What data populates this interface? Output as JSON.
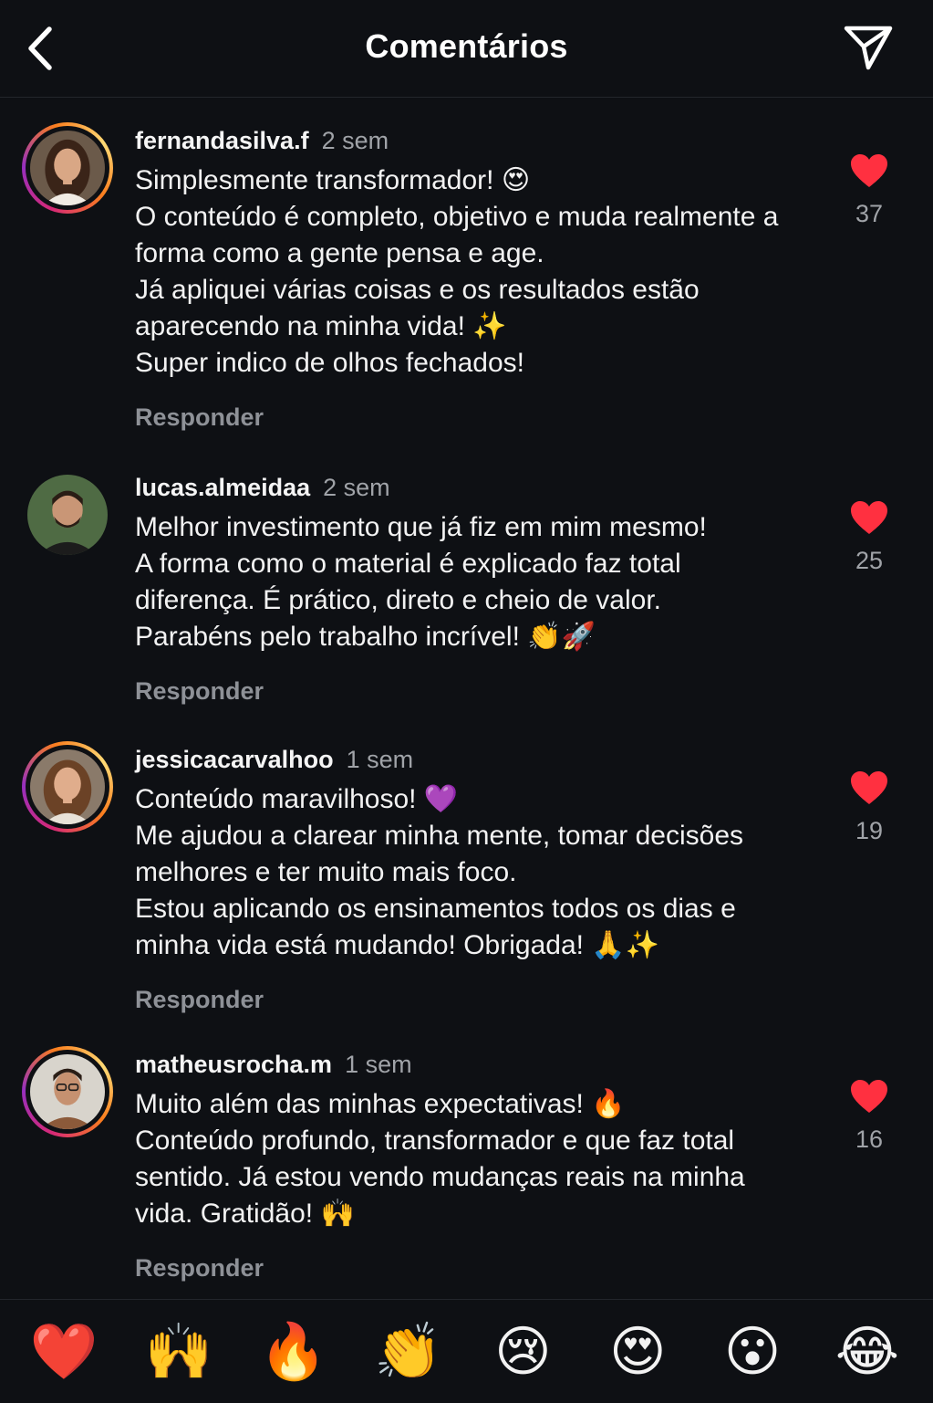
{
  "header": {
    "title": "Comentários",
    "back_icon": "chevron-left-icon",
    "share_icon": "send-icon"
  },
  "colors": {
    "background": "#0e1014",
    "heart": "#ff3040",
    "muted": "#a0a3a8"
  },
  "comments": [
    {
      "username": "fernandasilva.f",
      "time": "2 sem",
      "text": "Simplesmente transformador! 😍\nO conteúdo é completo, objetivo e muda realmente a forma como a gente pensa e age.\nJá apliquei várias coisas e os resultados estão aparecendo na minha vida! ✨\nSuper indico de olhos fechados!",
      "reply_label": "Responder",
      "likes": "37",
      "story_ring": true
    },
    {
      "username": "lucas.almeidaa",
      "time": "2 sem",
      "text": "Melhor investimento que já fiz em mim mesmo!\nA forma como o material é explicado faz total diferença.  É prático, direto e cheio de valor.\nParabéns pelo trabalho incrível! 👏🚀",
      "reply_label": "Responder",
      "likes": "25",
      "story_ring": false
    },
    {
      "username": "jessicacarvalhoo",
      "time": "1 sem",
      "text": "Conteúdo maravilhoso!  💜\nMe ajudou a clarear minha mente, tomar decisões melhores e ter muito mais foco.\nEstou aplicando os ensinamentos todos os dias e minha vida está mudando! Obrigada! 🙏✨",
      "reply_label": "Responder",
      "likes": "19",
      "story_ring": true
    },
    {
      "username": "matheusrocha.m",
      "time": "1 sem",
      "text": "Muito além das minhas expectativas!  🔥\nConteúdo profundo, transformador e que faz total sentido. Já estou vendo mudanças reais na minha vida. Gratidão!  🙌",
      "reply_label": "Responder",
      "likes": "16",
      "story_ring": true
    }
  ],
  "emoji_bar": [
    "❤️",
    "🙌",
    "🔥",
    "👏",
    "😢",
    "😍",
    "😮",
    "😂"
  ]
}
